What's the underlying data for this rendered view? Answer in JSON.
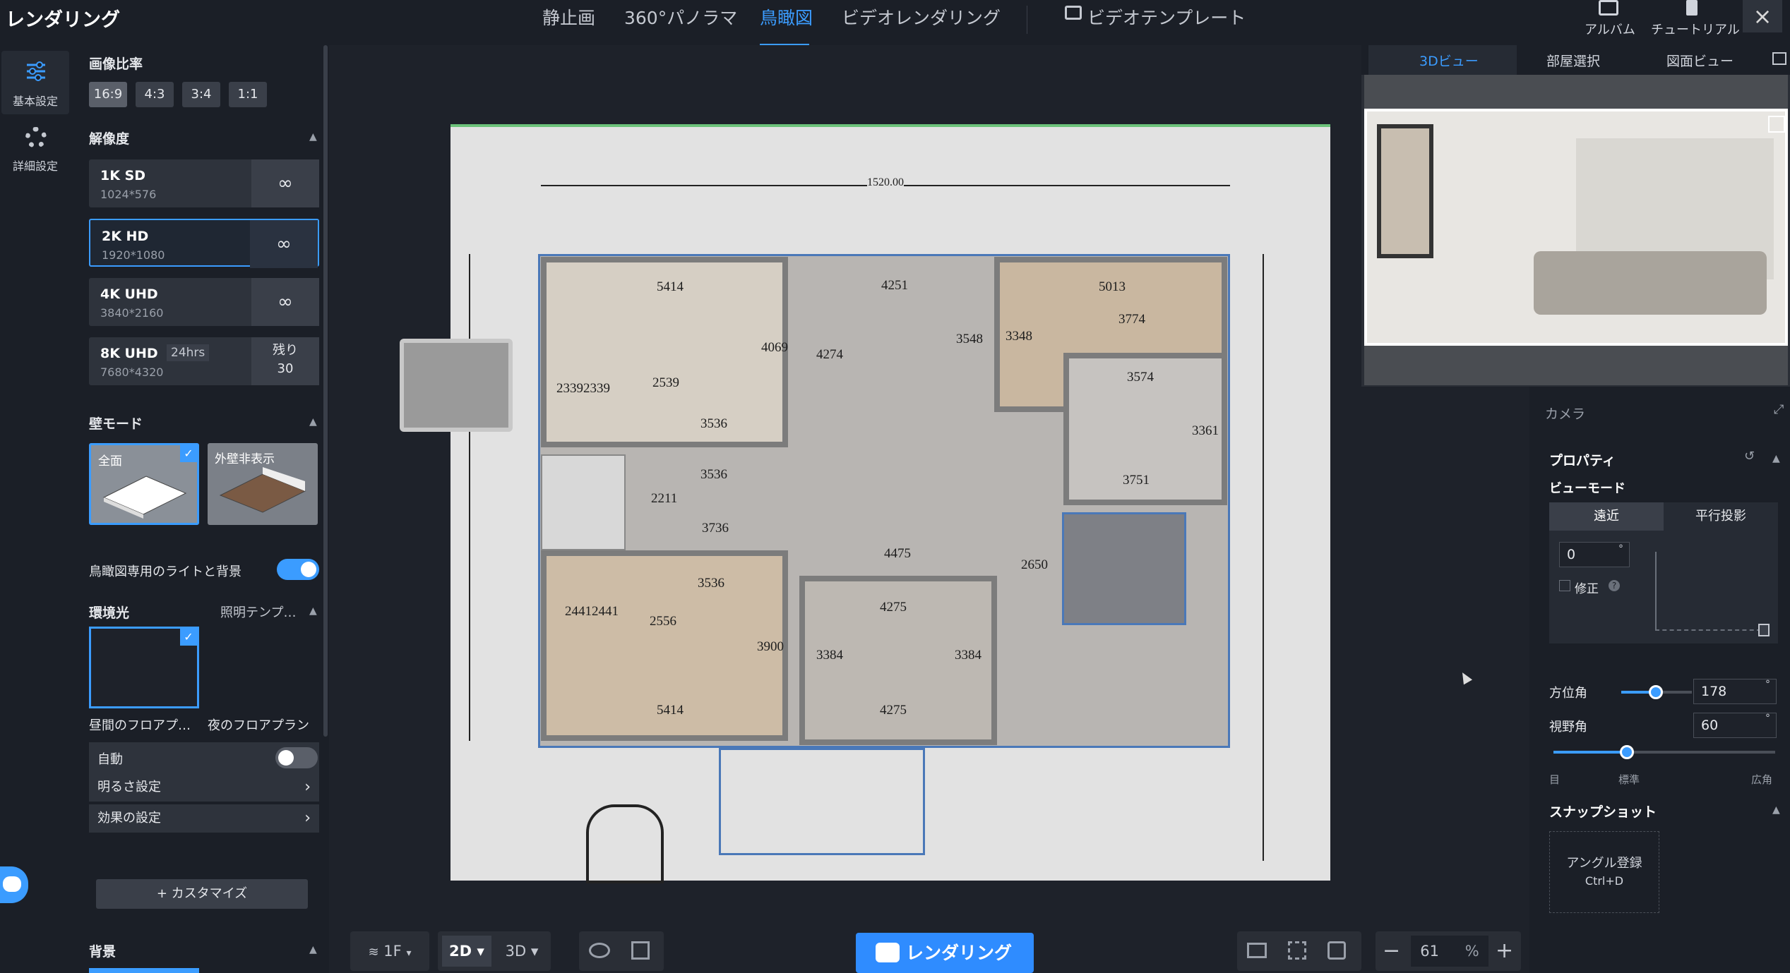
{
  "app_title": "レンダリング",
  "tabs": [
    "静止画",
    "360°パノラマ",
    "鳥瞰図",
    "ビデオレンダリング"
  ],
  "active_tab": "鳥瞰図",
  "video_template_label": "ビデオテンプレート",
  "top_icons": {
    "album": "アルバム",
    "tutorial": "チュートリアル"
  },
  "close_icon": "×",
  "left_rail": {
    "basic": "基本設定",
    "advanced": "詳細設定"
  },
  "settings": {
    "aspect_title": "画像比率",
    "aspect_options": [
      "16:9",
      "4:3",
      "3:4",
      "1:1"
    ],
    "aspect_selected": "16:9",
    "resolution_title": "解像度",
    "resolutions": [
      {
        "name": "1K SD",
        "dim": "1024*576",
        "side": "∞"
      },
      {
        "name": "2K HD",
        "dim": "1920*1080",
        "side": "∞"
      },
      {
        "name": "4K UHD",
        "dim": "3840*2160",
        "side": "∞"
      },
      {
        "name": "8K UHD",
        "badge": "24hrs",
        "dim": "7680*4320",
        "side_top": "残り",
        "side_bottom": "30"
      }
    ],
    "wall_title": "壁モード",
    "wall_options": [
      "全面",
      "外壁非表示"
    ],
    "birdseye_light": "鳥瞰図専用のライトと背景",
    "env_title": "環境光",
    "env_template": "照明テンプ…",
    "env_options": [
      "昼間のフロアプ…",
      "夜のフロアプラン"
    ],
    "auto_label": "自動",
    "brightness_label": "明るさ設定",
    "effect_label": "効果の設定",
    "customize_label": "+ カスタマイズ",
    "background_title": "背景"
  },
  "floorplan": {
    "labels": [
      "5414",
      "4251",
      "5013",
      "3774",
      "3574",
      "3348",
      "3548",
      "4274",
      "4069",
      "2539",
      "2339",
      "2339",
      "3536",
      "3536",
      "3736",
      "2211",
      "4475",
      "3751",
      "3361",
      "2650",
      "3536",
      "2441",
      "2441",
      "2556",
      "3900",
      "3384",
      "4275",
      "3384",
      "5414",
      "4275"
    ],
    "top_dim": "1520.00"
  },
  "preview": {
    "tabs": [
      "3Dビュー",
      "部屋選択",
      "図面ビュー"
    ],
    "active": "3Dビュー"
  },
  "camera": {
    "title": "カメラ",
    "properties": "プロパティ",
    "view_mode": "ビューモード",
    "mode_options": [
      "遠近",
      "平行投影"
    ],
    "tilt_value": "0",
    "degree": "°",
    "fix_label": "修正",
    "azimuth_label": "方位角",
    "azimuth_value": "178",
    "azimuth_fraction": 0.49,
    "fov_label": "視野角",
    "fov_value": "60",
    "fov_fraction": 0.33,
    "fov_scale": [
      "目",
      "標準",
      "広角"
    ],
    "snapshot_title": "スナップショット",
    "angle_register": "アングル登録",
    "angle_shortcut": "Ctrl+D"
  },
  "bottom": {
    "floor": "1F",
    "mode_2d": "2D",
    "mode_3d": "3D",
    "render_label": "レンダリング",
    "zoom_value": "61",
    "zoom_unit": "%"
  },
  "colors": {
    "accent": "#3b9cff",
    "panel": "#1b1f27",
    "render": "#2f8cff"
  }
}
